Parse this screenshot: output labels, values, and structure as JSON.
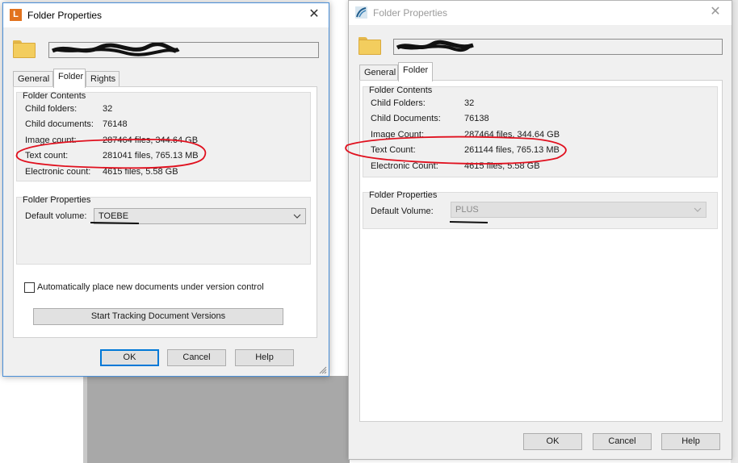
{
  "left_dialog": {
    "title": "Folder Properties",
    "app_icon_letter": "L",
    "tabs": [
      {
        "label": "General"
      },
      {
        "label": "Folder"
      },
      {
        "label": "Rights"
      }
    ],
    "contents_title": "Folder Contents",
    "rows": [
      {
        "label": "Child folders:",
        "value": "32"
      },
      {
        "label": "Child documents:",
        "value": "76148"
      },
      {
        "label": "Image count:",
        "value": "287464 files, 344.64 GB"
      },
      {
        "label": "Text count:",
        "value": "281041 files, 765.13 MB"
      },
      {
        "label": "Electronic count:",
        "value": "4615 files, 5.58 GB"
      }
    ],
    "props_title": "Folder Properties",
    "default_volume_label": "Default volume:",
    "default_volume_value": "TOEBE",
    "checkbox_label": "Automatically place new documents under version control",
    "track_button": "Start Tracking Document Versions",
    "ok": "OK",
    "cancel": "Cancel",
    "help": "Help"
  },
  "right_dialog": {
    "title": "Folder Properties",
    "tabs": [
      {
        "label": "General"
      },
      {
        "label": "Folder"
      }
    ],
    "contents_title": "Folder Contents",
    "rows": [
      {
        "label": "Child Folders:",
        "value": "32"
      },
      {
        "label": "Child Documents:",
        "value": "76138"
      },
      {
        "label": "Image Count:",
        "value": "287464 files, 344.64 GB"
      },
      {
        "label": "Text Count:",
        "value": "261144 files, 765.13 MB"
      },
      {
        "label": "Electronic Count:",
        "value": "4615 files, 5.58 GB"
      }
    ],
    "props_title": "Folder Properties",
    "default_volume_label": "Default Volume:",
    "default_volume_value": "PLUS",
    "ok": "OK",
    "cancel": "Cancel",
    "help": "Help"
  },
  "colors": {
    "annotation_red": "#e0101e",
    "primary_border": "#0078d7",
    "folder_yellow": "#f3cd5e"
  }
}
